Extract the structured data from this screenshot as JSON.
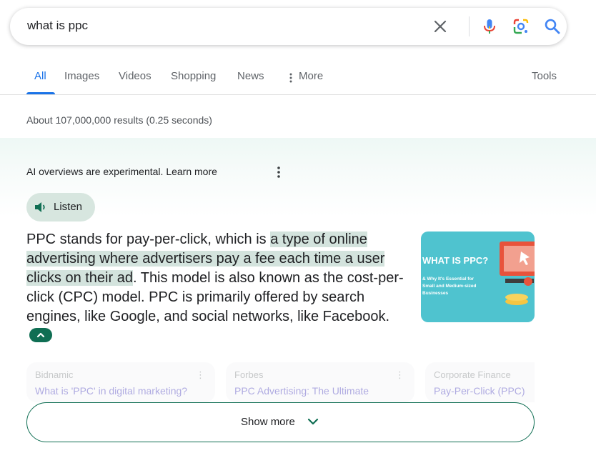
{
  "search": {
    "query": "what is ppc"
  },
  "tabs": [
    {
      "label": "All",
      "active": true
    },
    {
      "label": "Images"
    },
    {
      "label": "Videos"
    },
    {
      "label": "Shopping"
    },
    {
      "label": "News"
    },
    {
      "label": "More"
    },
    {
      "label": "Tools"
    }
  ],
  "results_stats": "About 107,000,000 results (0.25 seconds)",
  "ai_overview": {
    "notice": "AI overviews are experimental.",
    "learn_more": "Learn more",
    "listen_label": "Listen",
    "text_part1": "PPC stands for pay-per-click, which is ",
    "text_highlight": "a type of online advertising where advertisers pay a fee each time a user clicks on their ad",
    "text_part2": ". This model is also known as the cost-per-click (CPC) model. PPC is primarily offered by search engines, like Google, and social networks, like Facebook.",
    "image": {
      "title": "WHAT IS PPC?",
      "subtitle": "& Why It's Essential for Small and Medium-sized Businesses"
    },
    "sources": [
      {
        "site": "Bidnamic",
        "title": "What is 'PPC' in digital marketing?"
      },
      {
        "site": "Forbes",
        "title": "PPC Advertising: The Ultimate"
      },
      {
        "site": "Corporate Finance",
        "title": "Pay-Per-Click (PPC)"
      }
    ],
    "show_more": "Show more"
  },
  "colors": {
    "accent_blue": "#1a73e8",
    "ai_green": "#0f6e53",
    "highlight": "#d3e3dd"
  }
}
